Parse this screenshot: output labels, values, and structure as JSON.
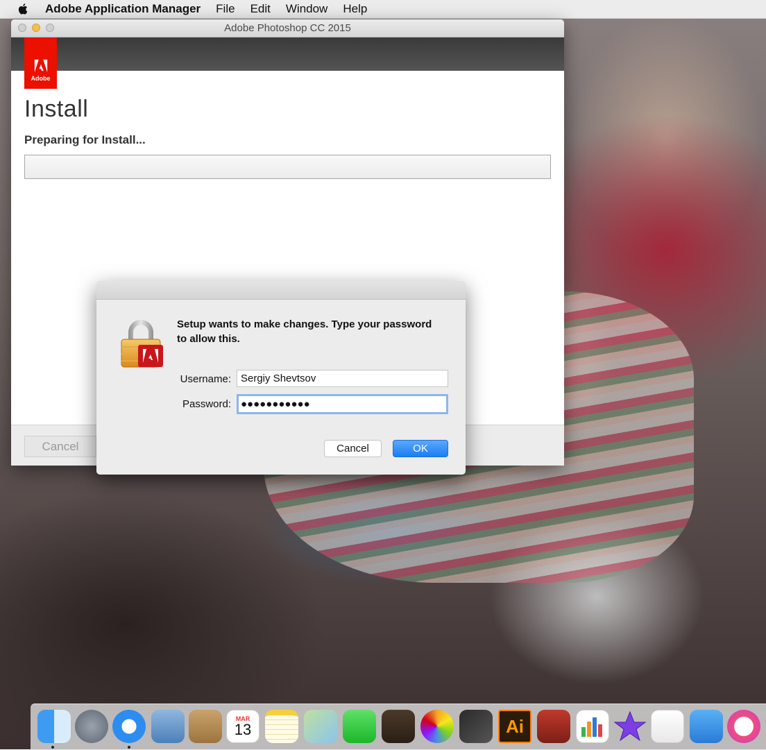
{
  "menubar": {
    "app_name": "Adobe Application Manager",
    "menus": [
      "File",
      "Edit",
      "Window",
      "Help"
    ]
  },
  "window": {
    "title": "Adobe Photoshop CC 2015",
    "logo_text": "Adobe",
    "heading": "Install",
    "status": "Preparing for Install...",
    "progress": 0,
    "cancel_label": "Cancel"
  },
  "auth_dialog": {
    "message": "Setup wants to make changes. Type your password to allow this.",
    "username_label": "Username:",
    "username_value": "Sergiy Shevtsov",
    "password_label": "Password:",
    "password_value": "●●●●●●●●●●●",
    "cancel_label": "Cancel",
    "ok_label": "OK"
  },
  "dock": {
    "icons": [
      "finder-icon",
      "launchpad-icon",
      "safari-icon",
      "mail-icon",
      "contacts-icon",
      "calendar-icon",
      "notes-icon",
      "maps-icon",
      "facetime-icon",
      "garageband-icon",
      "photos-icon",
      "final-cut-icon",
      "illustrator-icon",
      "photo-booth-icon",
      "numbers-icon",
      "imovie-icon",
      "pages-icon",
      "keynote-icon",
      "itunes-icon"
    ],
    "calendar_month": "MAR",
    "calendar_day": "13",
    "illustrator_label": "Ai"
  },
  "colors": {
    "adobe_red": "#eb1000",
    "ok_blue": "#1a7df4",
    "focus_ring": "#8cb6ea"
  }
}
